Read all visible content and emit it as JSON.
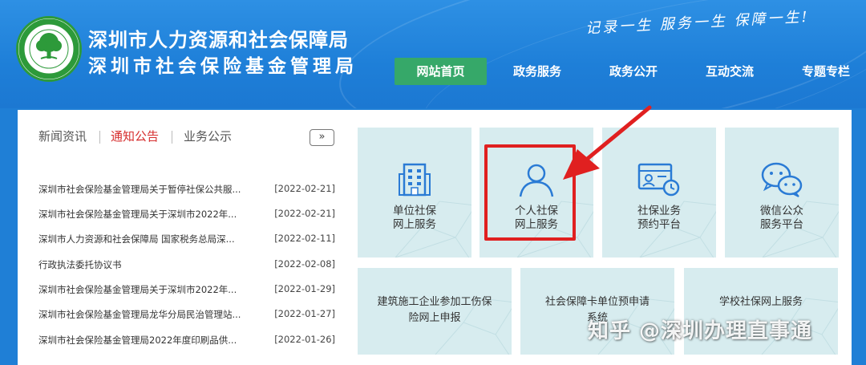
{
  "header": {
    "title": "深圳市人力资源和社会保障局",
    "subtitle": "深圳市社会保险基金管理局",
    "slogan": "记录一生 服务一生 保障一生!",
    "logo_icon": "tree-seal-icon"
  },
  "nav": {
    "items": [
      {
        "label": "网站首页",
        "active": true
      },
      {
        "label": "政务服务",
        "active": false
      },
      {
        "label": "政务公开",
        "active": false
      },
      {
        "label": "互动交流",
        "active": false
      },
      {
        "label": "专题专栏",
        "active": false
      }
    ]
  },
  "news": {
    "tabs": [
      {
        "label": "新闻资讯",
        "active": false
      },
      {
        "label": "通知公告",
        "active": true
      },
      {
        "label": "业务公示",
        "active": false
      }
    ],
    "more_label": "»",
    "items": [
      {
        "title": "深圳市社会保险基金管理局关于暂停社保公共服...",
        "date": "[2022-02-21]"
      },
      {
        "title": "深圳市社会保险基金管理局关于深圳市2022年...",
        "date": "[2022-02-21]"
      },
      {
        "title": "深圳市人力资源和社会保障局 国家税务总局深...",
        "date": "[2022-02-11]"
      },
      {
        "title": "行政执法委托协议书",
        "date": "[2022-02-08]"
      },
      {
        "title": "深圳市社会保险基金管理局关于深圳市2022年...",
        "date": "[2022-01-29]"
      },
      {
        "title": "深圳市社会保险基金管理局龙华分局民治管理站...",
        "date": "[2022-01-27]"
      },
      {
        "title": "深圳市社会保险基金管理局2022年度印刷品供...",
        "date": "[2022-01-26]"
      }
    ]
  },
  "services": {
    "row1": [
      {
        "line1": "单位社保",
        "line2": "网上服务",
        "icon": "building-icon"
      },
      {
        "line1": "个人社保",
        "line2": "网上服务",
        "icon": "person-icon"
      },
      {
        "line1": "社保业务",
        "line2": "预约平台",
        "icon": "appointment-card-icon"
      },
      {
        "line1": "微信公众",
        "line2": "服务平台",
        "icon": "wechat-icon"
      }
    ],
    "row2": [
      {
        "line1": "建筑施工企业参加工伤保",
        "line2": "险网上申报"
      },
      {
        "line1": "社会保障卡单位预申请",
        "line2": "系统"
      },
      {
        "line1": "学校社保网上服务",
        "line2": ""
      }
    ]
  },
  "watermark": {
    "text": "知乎 @深圳办理直事通"
  },
  "colors": {
    "header_blue": "#1f7fd6",
    "nav_active": "#36a869",
    "tile_bg": "#d7ecef",
    "icon_blue": "#2a7bd5",
    "highlight_red": "#e02020",
    "active_tab_red": "#d62d2d"
  }
}
